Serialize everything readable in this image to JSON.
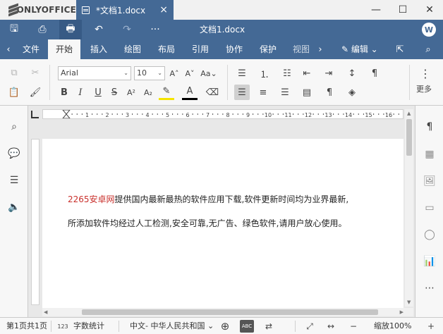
{
  "app": {
    "brand": "ONLYOFFICE"
  },
  "document_tab": {
    "name": "*文档1.docx",
    "close": "×"
  },
  "window_controls": {
    "minimize": "—",
    "maximize": "☐",
    "close": "✕"
  },
  "header": {
    "title": "文档1.docx",
    "avatar": "W",
    "quick": {
      "save": "🖫",
      "print": "⎙",
      "quickprint": "🖶",
      "undo": "↶",
      "redo": "↷",
      "more": "···"
    }
  },
  "tabs": [
    "文件",
    "开始",
    "插入",
    "绘图",
    "布局",
    "引用",
    "协作",
    "保护",
    "视图"
  ],
  "active_tab": "开始",
  "nav": {
    "prev": "‹",
    "next": "›"
  },
  "edit_mode": {
    "label": "✎ 编辑 ⌄"
  },
  "tab_icons": {
    "open_location": "⇱",
    "search": "⌕"
  },
  "toolbar": {
    "font_name": "Arial",
    "font_size": "10",
    "more_label": "更多",
    "dropdown_arrow": "⌄",
    "icons": {
      "copy": "⧉",
      "cut": "✂",
      "paste": "📋",
      "format_painter": "🖌",
      "grow": "A˄",
      "shrink": "A˅",
      "case": "Aa⌄",
      "bold": "B",
      "italic": "I",
      "underline": "U",
      "strike": "S",
      "superscript": "A²",
      "subscript": "A₂",
      "highlight": "✎",
      "fontcolor": "A",
      "clear": "⌫",
      "bullets": "☰",
      "numbering": "⒈",
      "multilevel": "☷",
      "dec_indent": "⇤",
      "inc_indent": "⇥",
      "linespacing": "↕",
      "para": "¶",
      "align_left": "☰",
      "align_center": "≡",
      "align_right": "☰",
      "justify": "▤",
      "nonprint": "¶",
      "shading": "◈",
      "more": "⋮"
    }
  },
  "left_panel": {
    "search": "⌕",
    "comments": "💬",
    "headings": "☰",
    "speech": "🔈"
  },
  "right_panel": {
    "paragraph": "¶",
    "table": "▦",
    "image": "🖼",
    "header": "▭",
    "shape": "◯",
    "chart": "📊",
    "more": "⋯"
  },
  "ruler": {
    "numbers": [
      "1",
      "2",
      "3",
      "4",
      "5",
      "6",
      "7",
      "8",
      "9",
      "10",
      "11",
      "12",
      "13",
      "14",
      "15",
      "16"
    ]
  },
  "document": {
    "line1_red": "2265安卓网",
    "line1_rest": "提供国内最新最热的软件应用下载,软件更新时间均为业界最新,",
    "line2": "所添加软件均经过人工检测,安全可靠,无广告、绿色软件,请用户放心使用。"
  },
  "statusbar": {
    "page": "第1页共1页",
    "word_count": "字数统计",
    "language": "中文- 中华人民共和国 ⌄",
    "zoom": "缩放100%",
    "icons": {
      "wordcount": "123",
      "globe": "⊕",
      "spell": "ABC",
      "track": "⇄",
      "fitpage": "⤢",
      "fitwidth": "↔",
      "zoomout": "−",
      "zoomin": "+"
    }
  }
}
